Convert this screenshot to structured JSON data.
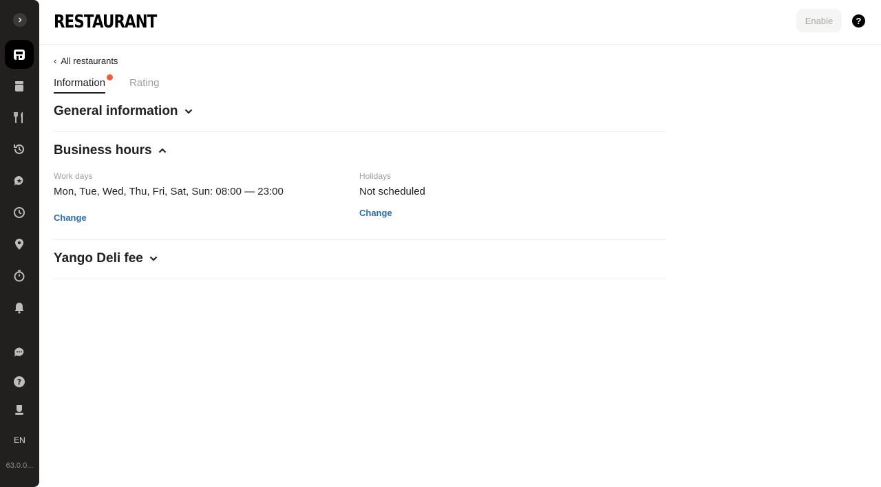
{
  "sidebar": {
    "items": [
      {
        "name": "restaurant",
        "icon": "store-icon",
        "active": true
      },
      {
        "name": "orders",
        "icon": "bag-icon",
        "active": false
      },
      {
        "name": "menu",
        "icon": "fork-knife-icon",
        "active": false
      },
      {
        "name": "history",
        "icon": "history-icon",
        "active": false
      },
      {
        "name": "reviews",
        "icon": "star-chat-icon",
        "active": false
      },
      {
        "name": "schedule",
        "icon": "clock-icon",
        "active": false
      },
      {
        "name": "locations",
        "icon": "pin-icon",
        "active": false
      },
      {
        "name": "timer",
        "icon": "stopwatch-icon",
        "active": false
      },
      {
        "name": "notifications",
        "icon": "bell-icon",
        "active": false
      },
      {
        "name": "chat",
        "icon": "chat-icon",
        "active": false
      },
      {
        "name": "help",
        "icon": "help-icon",
        "active": false
      },
      {
        "name": "profile",
        "icon": "user-icon",
        "active": false
      }
    ],
    "language": "EN",
    "version": "63.0.0..."
  },
  "header": {
    "brand": "RESTAURANT",
    "enable_label": "Enable"
  },
  "main": {
    "back_link": "All restaurants",
    "tabs": [
      {
        "label": "Information",
        "active": true,
        "has_dot": true
      },
      {
        "label": "Rating",
        "active": false
      }
    ],
    "sections": {
      "general": {
        "title": "General information",
        "expanded": false
      },
      "business_hours": {
        "title": "Business hours",
        "expanded": true,
        "work_days_label": "Work days",
        "work_days_value": "Mon, Tue, Wed, Thu, Fri, Sat, Sun: 08:00 — 23:00",
        "work_days_change": "Change",
        "holidays_label": "Holidays",
        "holidays_value": "Not scheduled",
        "holidays_change": "Change"
      },
      "fee": {
        "title": "Yango Deli fee",
        "expanded": false
      }
    }
  },
  "colors": {
    "sidebar_bg": "#21201f",
    "active_item_bg": "#000000",
    "link": "#2b6cb0",
    "badge_dot": "#f05b42"
  }
}
